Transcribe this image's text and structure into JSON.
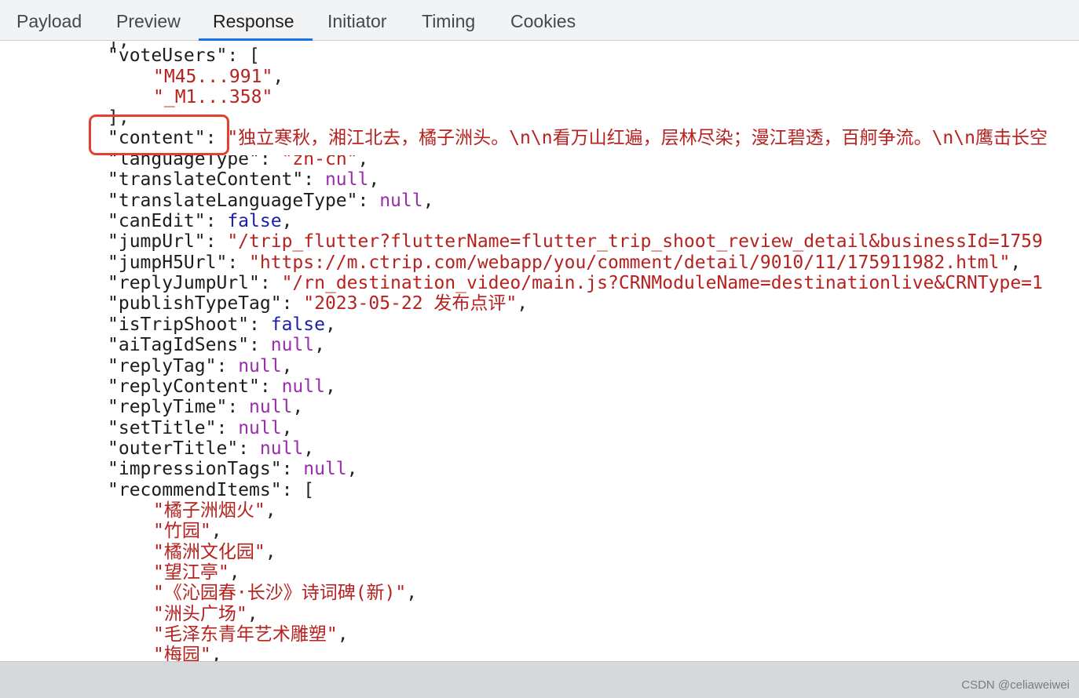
{
  "tabs": [
    {
      "label": "Payload"
    },
    {
      "label": "Preview"
    },
    {
      "label": "Response"
    },
    {
      "label": "Initiator"
    },
    {
      "label": "Timing"
    },
    {
      "label": "Cookies"
    }
  ],
  "active_tab": "Response",
  "response": {
    "top_cut": "],",
    "vote_users_key": "\"voteUsers\"",
    "vote_users": [
      "\"M45...991\"",
      "\"_M1...358\""
    ],
    "content_key": "\"content\"",
    "content_value": "\"独立寒秋，湘江北去，橘子洲头。\\n\\n看万山红遍，层林尽染；漫江碧透，百舸争流。\\n\\n鹰击长空",
    "language_type_key": "\"languageType\"",
    "language_type_value": "\"zh-cn\"",
    "translate_content_key": "\"translateContent\"",
    "translate_language_type_key": "\"translateLanguageType\"",
    "can_edit_key": "\"canEdit\"",
    "jump_url_key": "\"jumpUrl\"",
    "jump_url_value": "\"/trip_flutter?flutterName=flutter_trip_shoot_review_detail&businessId=1759",
    "jump_h5_url_key": "\"jumpH5Url\"",
    "jump_h5_url_value": "\"https://m.ctrip.com/webapp/you/comment/detail/9010/11/175911982.html\"",
    "reply_jump_url_key": "\"replyJumpUrl\"",
    "reply_jump_url_value": "\"/rn_destination_video/main.js?CRNModuleName=destinationlive&CRNType=1",
    "publish_type_tag_key": "\"publishTypeTag\"",
    "publish_type_tag_value": "\"2023-05-22 发布点评\"",
    "is_trip_shoot_key": "\"isTripShoot\"",
    "ai_tag_id_sens_key": "\"aiTagIdSens\"",
    "reply_tag_key": "\"replyTag\"",
    "reply_content_key": "\"replyContent\"",
    "reply_time_key": "\"replyTime\"",
    "set_title_key": "\"setTitle\"",
    "outer_title_key": "\"outerTitle\"",
    "impression_tags_key": "\"impressionTags\"",
    "recommend_items_key": "\"recommendItems\"",
    "recommend_items": [
      "\"橘子洲烟火\"",
      "\"竹园\"",
      "\"橘洲文化园\"",
      "\"望江亭\"",
      "\"《沁园春·长沙》诗词碑(新)\"",
      "\"洲头广场\"",
      "\"毛泽东青年艺术雕塑\"",
      "\"梅园\""
    ],
    "null_literal": "null",
    "false_literal": "false",
    "colon": ": ",
    "comma": ",",
    "open_bracket": "["
  },
  "watermark": "CSDN @celiaweiwei",
  "colors": {
    "string": "#b5221f",
    "null": "#9a2dac",
    "boolean": "#1b1fa6",
    "tab_accent": "#1a73e8",
    "highlight_box": "#e2412f"
  }
}
